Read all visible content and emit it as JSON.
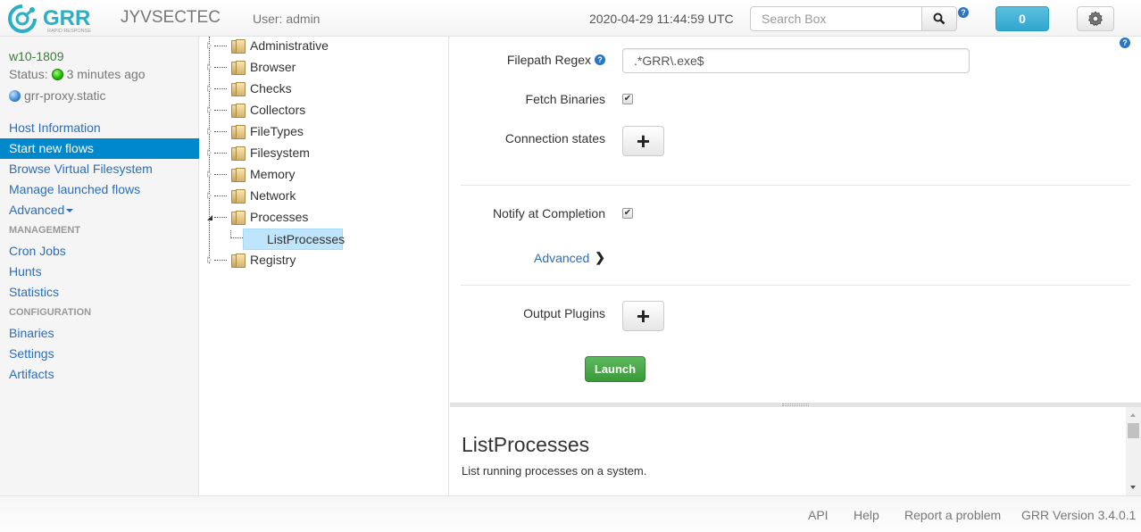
{
  "navbar": {
    "logo_text": "GRR",
    "logo_subtext": "RAPID RESPONSE",
    "brand": "JYVSECTEC",
    "user": "User: admin",
    "clock": "2020-04-29 11:44:59 UTC",
    "search_placeholder": "Search Box",
    "search_icon": "search-icon",
    "help_icon": "?",
    "notifications_count": "0",
    "settings_icon": "gear-icon"
  },
  "client": {
    "name": "w10-1809",
    "status_label": "Status:",
    "status_value": "3 minutes ago",
    "host": "grr-proxy.static"
  },
  "sidebar": {
    "items": [
      {
        "label": "Host Information"
      },
      {
        "label": "Start new flows",
        "active": true
      },
      {
        "label": "Browse Virtual Filesystem"
      },
      {
        "label": "Manage launched flows"
      },
      {
        "label": "Advanced"
      }
    ],
    "management_header": "MANAGEMENT",
    "management_items": [
      {
        "label": "Cron Jobs"
      },
      {
        "label": "Hunts"
      },
      {
        "label": "Statistics"
      }
    ],
    "configuration_header": "CONFIGURATION",
    "configuration_items": [
      {
        "label": "Binaries"
      },
      {
        "label": "Settings"
      },
      {
        "label": "Artifacts"
      }
    ]
  },
  "tree": {
    "folders": [
      {
        "label": "Administrative"
      },
      {
        "label": "Browser"
      },
      {
        "label": "Checks"
      },
      {
        "label": "Collectors"
      },
      {
        "label": "FileTypes"
      },
      {
        "label": "Filesystem"
      },
      {
        "label": "Memory"
      },
      {
        "label": "Network"
      },
      {
        "label": "Processes",
        "expanded": true
      },
      {
        "label": "Registry"
      }
    ],
    "selected_leaf": "ListProcesses"
  },
  "form": {
    "filepath_regex_label": "Filepath Regex",
    "filepath_regex_value": ".*GRR\\.exe$",
    "fetch_binaries_label": "Fetch Binaries",
    "fetch_binaries_checked": true,
    "connection_states_label": "Connection states",
    "notify_label": "Notify at Completion",
    "notify_checked": true,
    "advanced_label": "Advanced",
    "output_plugins_label": "Output Plugins",
    "add_symbol": "+",
    "launch_label": "Launch",
    "check_mark": "✔",
    "chevron": "❯"
  },
  "description": {
    "title": "ListProcesses",
    "text": "List running processes on a system."
  },
  "footer": {
    "api": "API",
    "help": "Help",
    "report": "Report a problem",
    "version": "GRR Version 3.4.0.1"
  }
}
